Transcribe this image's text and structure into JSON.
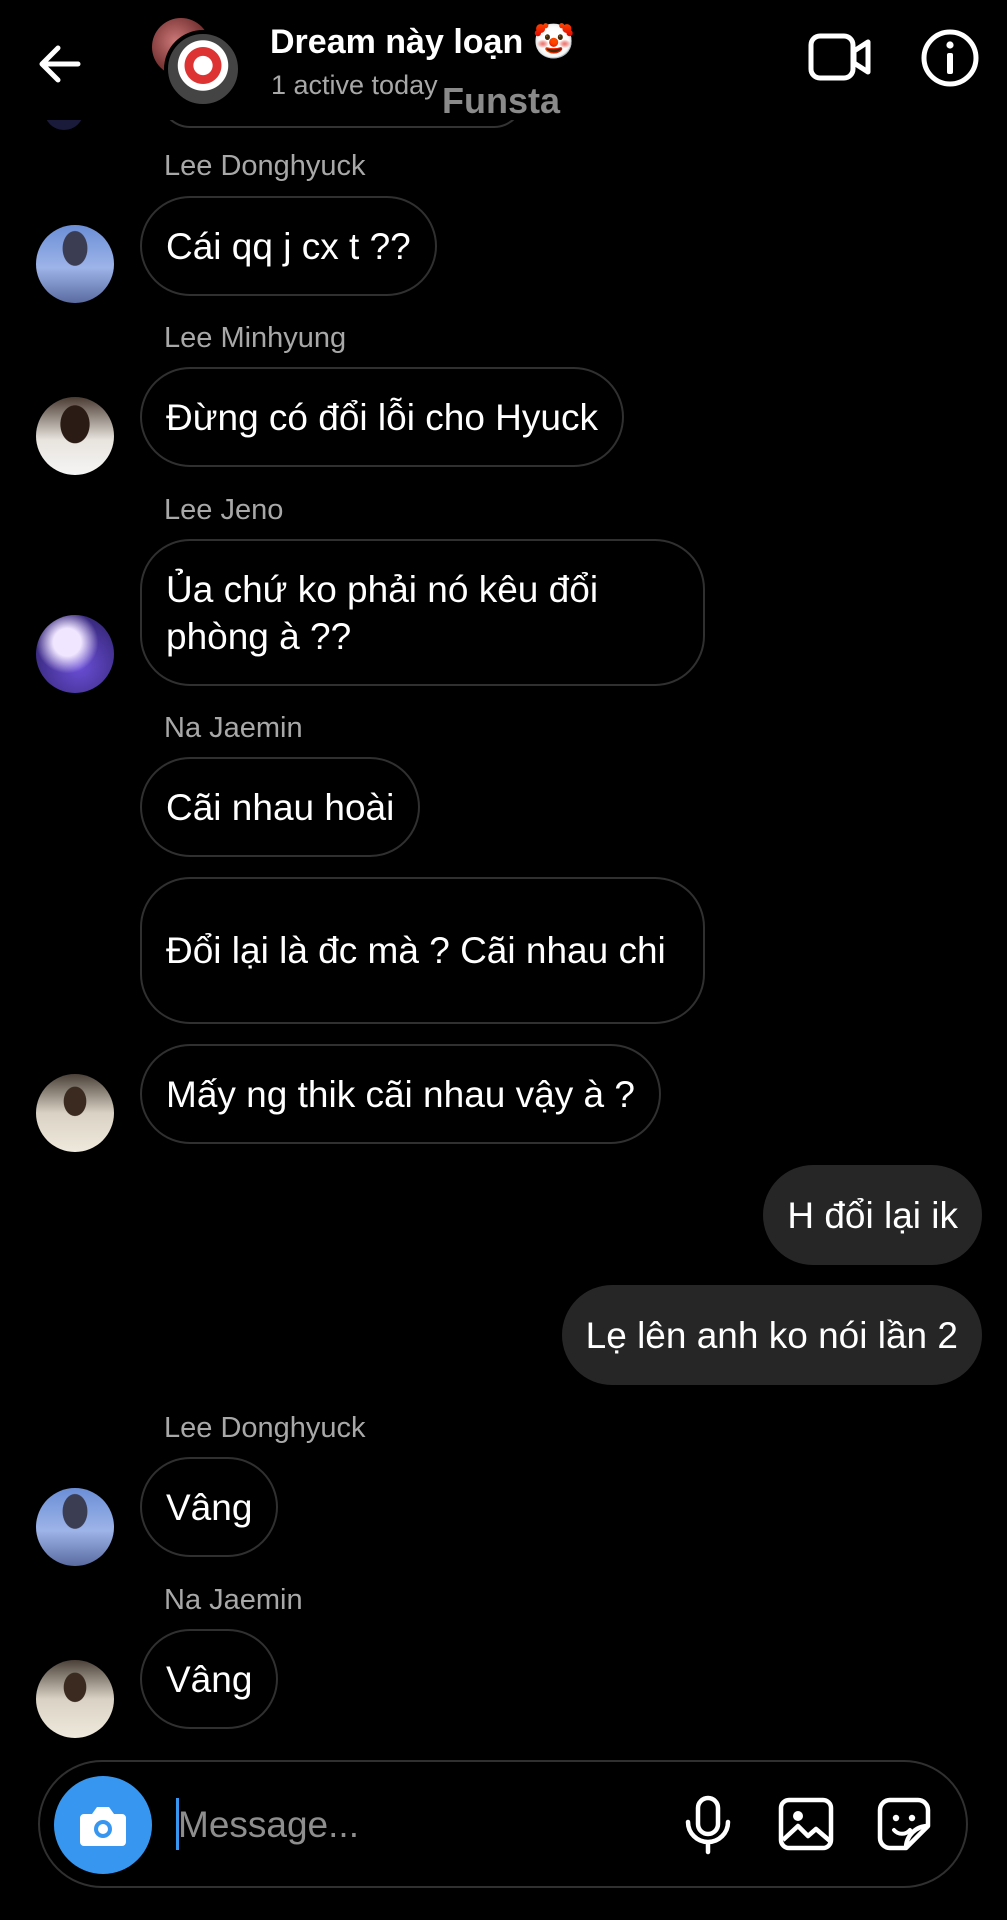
{
  "header": {
    "title": "Dream này loạn 🤡",
    "status": "1 active today",
    "watermark": "Funsta",
    "icons": {
      "back": "back-arrow-icon",
      "video": "video-call-icon",
      "info": "info-icon"
    }
  },
  "messages": [
    {
      "sender": "Lee Donghyuck",
      "text": "Cái qq j cx t ??"
    },
    {
      "sender": "Lee Minhyung",
      "text": "Đừng có đổi lỗi cho Hyuck"
    },
    {
      "sender": "Lee Jeno",
      "text": "Ủa chứ ko phải nó kêu đổi phòng à ??"
    },
    {
      "sender": "Na Jaemin",
      "text": "Cãi nhau hoài"
    },
    {
      "sender": "Na Jaemin",
      "text": "Đổi lại là đc mà ? Cãi nhau chi"
    },
    {
      "sender": "Na Jaemin",
      "text": "Mấy ng thik cãi nhau vậy à ?"
    },
    {
      "sender": "me",
      "text": "H đổi lại ik"
    },
    {
      "sender": "me",
      "text": "Lẹ lên anh ko nói lần 2"
    },
    {
      "sender": "Lee Donghyuck",
      "text": "Vâng"
    },
    {
      "sender": "Na Jaemin",
      "text": "Vâng"
    }
  ],
  "composer": {
    "placeholder": "Message...",
    "icons": {
      "camera": "camera-icon",
      "mic": "microphone-icon",
      "gallery": "gallery-icon",
      "sticker": "sticker-icon"
    },
    "accent": "#3797f0"
  },
  "colors": {
    "background": "#000000",
    "outgoing_bubble": "#262626",
    "bubble_border": "#303030",
    "secondary_text": "#a8a8a8"
  }
}
